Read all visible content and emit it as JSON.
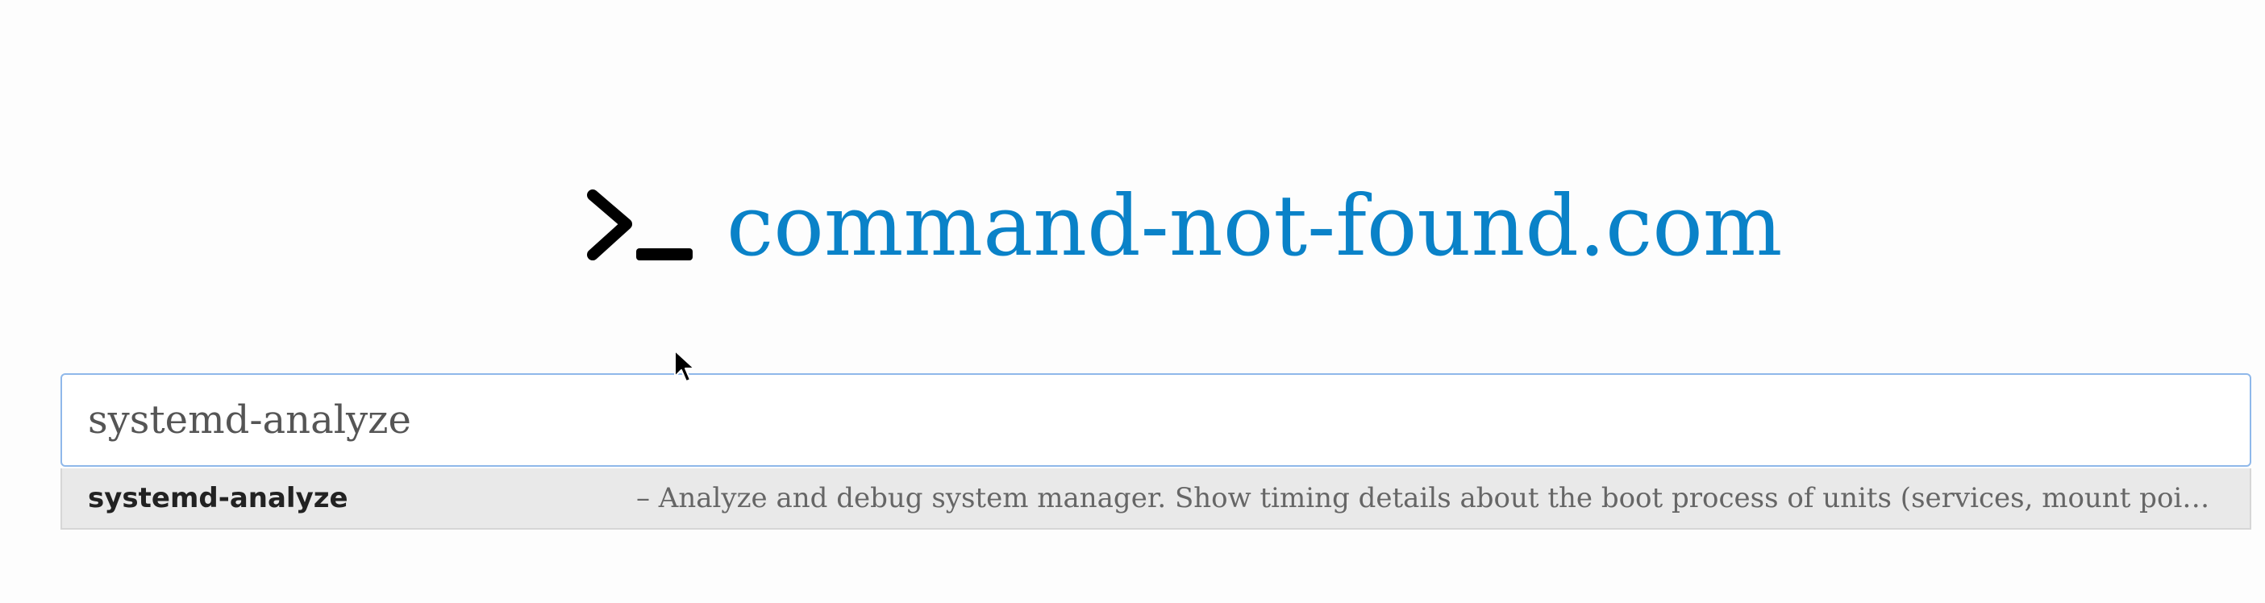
{
  "site": {
    "logo_icon": "terminal-prompt-icon",
    "title": "command-not-found.com",
    "brand_color": "#0a82c8"
  },
  "search": {
    "value": "systemd-analyze",
    "placeholder": ""
  },
  "suggestions": [
    {
      "name": "systemd-analyze",
      "description": "– Analyze and debug system manager. Show timing details about the boot process of units (services, mount points, devices, sockets)."
    }
  ],
  "cursor": {
    "icon": "mouse-pointer-icon"
  }
}
